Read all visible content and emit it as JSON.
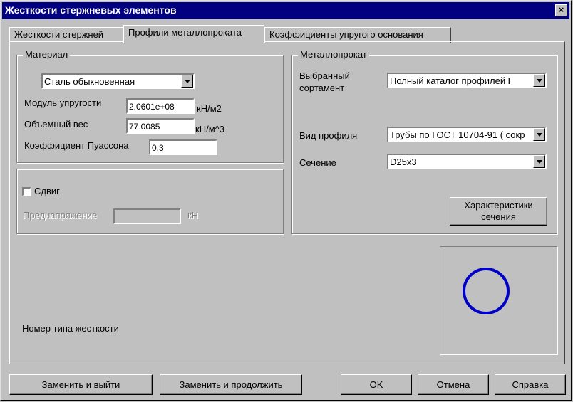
{
  "window": {
    "title": "Жесткости стержневых элементов",
    "close": "×"
  },
  "tabs": [
    {
      "label": "Жесткости стержней"
    },
    {
      "label": "Профили металлопроката"
    },
    {
      "label": "Коэффициенты упругого основания"
    }
  ],
  "material": {
    "legend": "Материал",
    "steel": "Сталь обыкновенная",
    "elastic_label": "Модуль упругости",
    "elastic_value": "2.0601e+08",
    "elastic_unit": "кН/м2",
    "weight_label": "Объемный вес",
    "weight_value": "77.0085",
    "weight_unit": "кН/м^3",
    "poisson_label": "Коэффициент Пуассона",
    "poisson_value": "0.3"
  },
  "shear": {
    "checkbox_label": "Сдвиг",
    "prestress_label": "Преднапряжение",
    "prestress_value": "",
    "prestress_unit": "кН"
  },
  "metal": {
    "legend": "Металлопрокат",
    "assortment_label_1": "Выбранный",
    "assortment_label_2": "сортамент",
    "assortment_value": "Полный каталог профилей Г",
    "profile_label": "Вид профиля",
    "profile_value": "Трубы по ГОСТ 10704-91 ( сокр",
    "section_label": "Сечение",
    "section_value": "D25x3",
    "char_button_1": "Характеристики",
    "char_button_2": "сечения"
  },
  "stiffness_type_label": "Номер типа жесткости",
  "preview": {
    "shape": "circle-icon",
    "color": "#0000c8"
  },
  "buttons": {
    "replace_exit": "Заменить и выйти",
    "replace_continue": "Заменить и продолжить",
    "ok": "OK",
    "cancel": "Отмена",
    "help": "Справка"
  }
}
